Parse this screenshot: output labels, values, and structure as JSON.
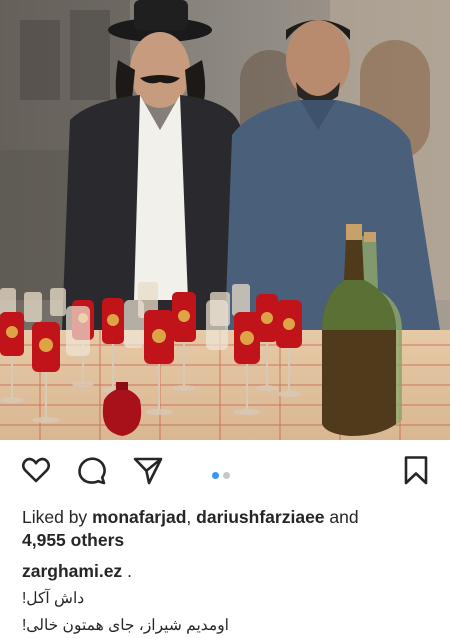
{
  "photo": {
    "description_name": "post-photo"
  },
  "actions": {
    "icons": [
      "heart-icon",
      "comment-icon",
      "share-icon",
      "bookmark-icon"
    ],
    "carousel": {
      "count": 2,
      "active": 0
    },
    "colors": {
      "icon": "#262626",
      "dot_active": "#3897f0",
      "dot_inactive": "#c7c7c7"
    }
  },
  "likes": {
    "prefix": "Liked by",
    "user1": "monafarjad",
    "separator": ",",
    "user2": "dariushfarziaee",
    "and": "and",
    "others": "4,955 others"
  },
  "caption": {
    "username": "zarghami.ez",
    "dot": ".",
    "lines": [
      "داش آکل!",
      "اومدیم شیراز، جای همتون خالی!"
    ]
  }
}
